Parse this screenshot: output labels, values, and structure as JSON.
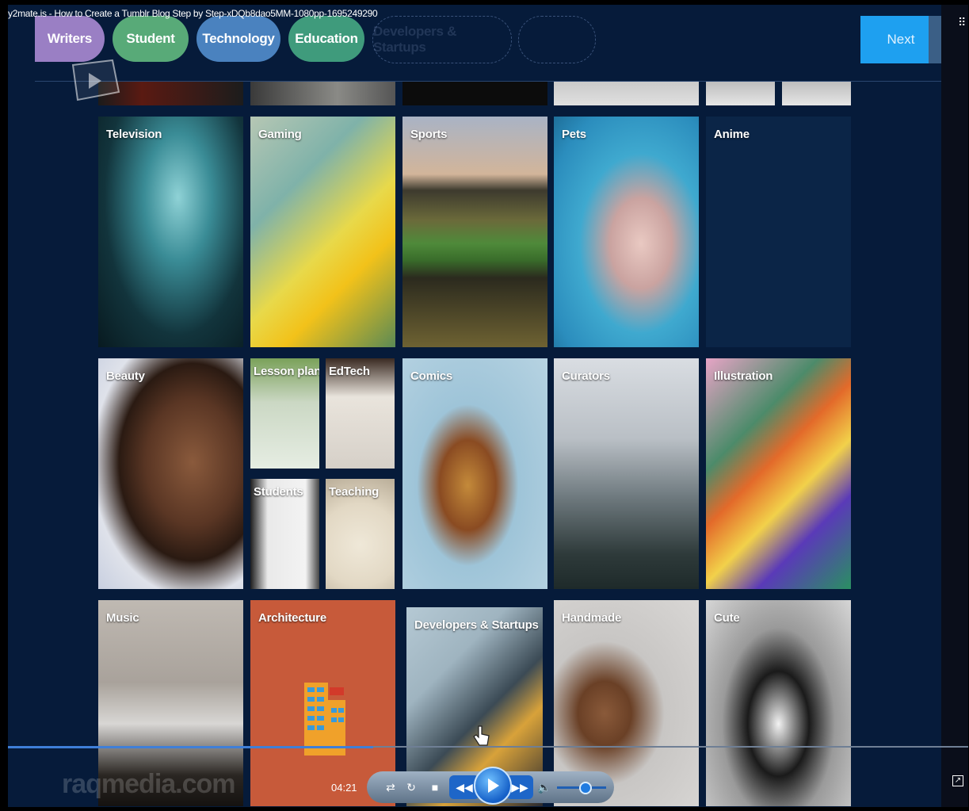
{
  "window": {
    "title": "y2mate.is - How to Create a Tumblr Blog Step by Step-xDQb8dao5MM-1080pp-1695249290"
  },
  "tag_bar": {
    "tags": [
      {
        "label": "Writers"
      },
      {
        "label": "Student"
      },
      {
        "label": "Technology"
      },
      {
        "label": "Education"
      },
      {
        "label": "Developers & Startups"
      }
    ],
    "next_label": "Next"
  },
  "tiles": {
    "television": "Television",
    "gaming": "Gaming",
    "sports": "Sports",
    "pets": "Pets",
    "anime": "Anime",
    "beauty": "Beauty",
    "lesson_plan": "Lesson plan",
    "edtech": "EdTech",
    "students": "Students",
    "teaching": "Teaching",
    "comics": "Comics",
    "curators": "Curators",
    "illustration": "Illustration",
    "music": "Music",
    "architecture": "Architecture",
    "developers_startups": "Developers & Startups",
    "handmade": "Handmade",
    "cute": "Cute"
  },
  "player": {
    "watermark": "raqmedia.com",
    "elapsed_time": "04:21",
    "progress": 0.38,
    "volume": 0.55
  },
  "colors": {
    "background": "#061b3a",
    "next_button": "#1ea0f0",
    "anime_tile": "#0b2547"
  }
}
